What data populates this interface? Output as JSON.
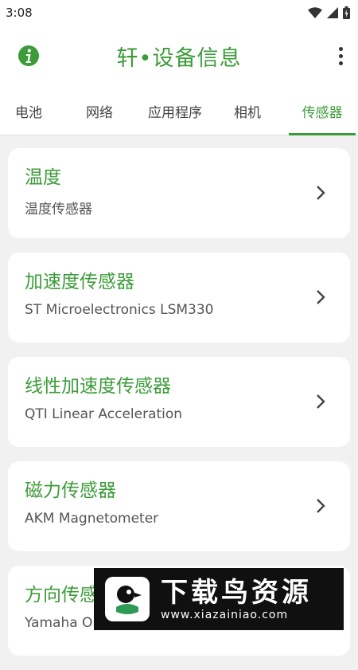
{
  "status": {
    "time": "3:08"
  },
  "app": {
    "title": "轩•设备信息"
  },
  "tabs": [
    {
      "label": "电池"
    },
    {
      "label": "网络"
    },
    {
      "label": "应用程序"
    },
    {
      "label": "相机"
    },
    {
      "label": "传感器"
    }
  ],
  "active_tab": "传感器",
  "sensors": [
    {
      "title": "温度",
      "subtitle": "温度传感器"
    },
    {
      "title": "加速度传感器",
      "subtitle": "ST Microelectronics LSM330"
    },
    {
      "title": "线性加速度传感器",
      "subtitle": "QTI Linear Acceleration"
    },
    {
      "title": "磁力传感器",
      "subtitle": "AKM Magnetometer"
    },
    {
      "title": "方向传感器",
      "subtitle": "Yamaha Orientation"
    }
  ],
  "watermark": {
    "title": "下载鸟资源",
    "url": "www.xiazainiao.com"
  },
  "colors": {
    "accent": "#3d9c3a",
    "background": "#f1f1f1"
  },
  "icons": {
    "app_bar": [
      "info-icon",
      "more-vert-icon"
    ],
    "status": [
      "wifi-icon",
      "cell-signal-icon",
      "battery-icon"
    ],
    "row": "chevron-right-icon"
  }
}
